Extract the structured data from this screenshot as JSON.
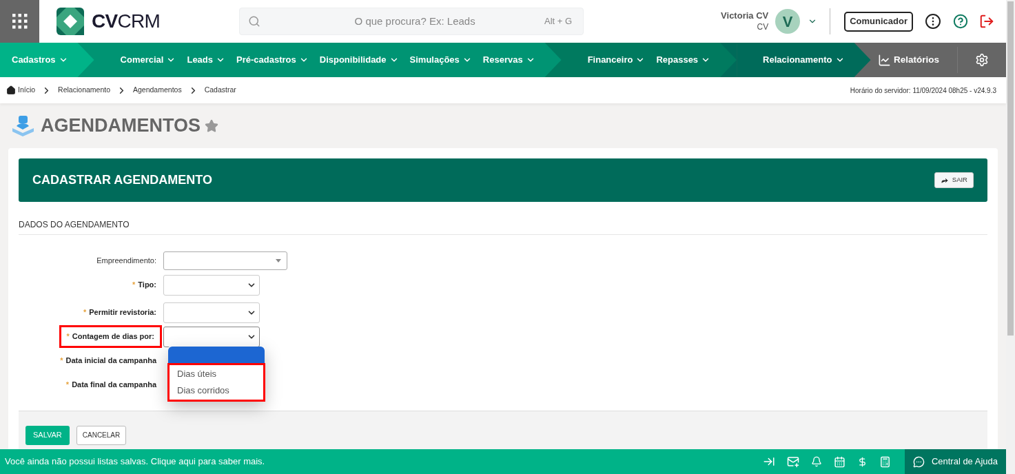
{
  "header": {
    "logo_text_bold": "CV",
    "logo_text": "CRM",
    "search": {
      "placeholder": "O que procura? Ex: Leads",
      "shortcut": "Alt + G"
    },
    "user": {
      "name": "Victoria CV",
      "role": "CV",
      "avatar_letter": "V"
    },
    "communicator_button": "Comunicador"
  },
  "nav": {
    "groups": [
      {
        "color": "#00b388",
        "items": [
          "Cadastros"
        ]
      },
      {
        "color": "#009473",
        "items": [
          "Comercial",
          "Leads",
          "Pré-cadastros",
          "Disponibilidade",
          "Simulações",
          "Reservas"
        ]
      },
      {
        "color": "#007a5f",
        "items": [
          "Financeiro",
          "Repasses"
        ]
      },
      {
        "color": "#006b5a",
        "items": [
          "Relacionamento"
        ]
      }
    ],
    "reports": "Relatórios"
  },
  "breadcrumb": {
    "items": [
      "Início",
      "Relacionamento",
      "Agendamentos",
      "Cadastrar"
    ],
    "server_time": "Horário do servidor: 11/09/2024 08h25 - v24.9.3"
  },
  "page": {
    "title": "AGENDAMENTOS",
    "favorite": false
  },
  "form": {
    "title": "CADASTRAR AGENDAMENTO",
    "required_mark": "*",
    "exit_button": "SAIR",
    "section": "DADOS DO AGENDAMENTO",
    "fields": [
      {
        "kind": "combo",
        "label": "Empreendimento:",
        "required": false,
        "annotated": false
      },
      {
        "kind": "select",
        "label": "Tipo:",
        "required": true,
        "annotated": false
      },
      {
        "kind": "select",
        "label": "Permitir revistoria:",
        "required": true,
        "annotated": false
      },
      {
        "kind": "select",
        "label": "Contagem de dias por:",
        "required": true,
        "annotated": true,
        "expanded": true,
        "options_annotated": true,
        "options": [
          {
            "label": "Dias úteis",
            "selected": false
          },
          {
            "label": "Dias corridos",
            "selected": false
          }
        ]
      },
      {
        "kind": "date",
        "label": "Data inicial da campanha",
        "required": true,
        "annotated": false
      },
      {
        "kind": "date",
        "label": "Data final da campanha",
        "required": true,
        "annotated": false
      }
    ],
    "buttons": [
      {
        "kind": "primary",
        "label": "SALVAR"
      },
      {
        "kind": "secondary",
        "label": "CANCELAR"
      }
    ]
  },
  "footer": {
    "message": "Você ainda não possui listas salvas. Clique aqui para saber mais.",
    "help": "Central de Ajuda"
  }
}
